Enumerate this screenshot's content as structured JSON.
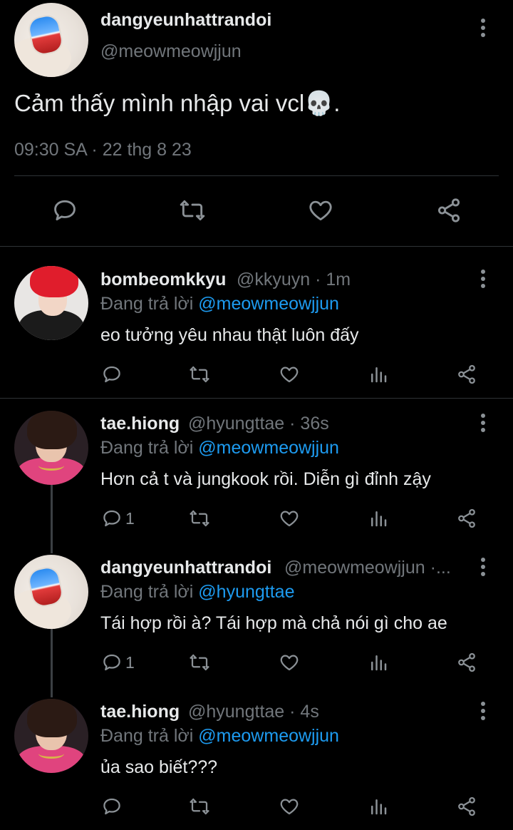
{
  "main_tweet": {
    "display_name": "dangyeunhattrandoi",
    "handle": "@meowmeowjjun",
    "text": "Cảm thấy mình nhập vai vcl💀.",
    "timestamp": "09:30 SA · 22 thg 8 23"
  },
  "replies": [
    {
      "display_name": "bombeomkkyu",
      "meta": "@kkyuyn · 1m",
      "replying_prefix": "Đang trả lời",
      "replying_to": "@meowmeowjjun",
      "text": "eo tưởng yêu nhau thật luôn đấy",
      "reply_count": ""
    },
    {
      "display_name": "tae.hiong",
      "meta": "@hyungttae · 36s",
      "replying_prefix": "Đang trả lời",
      "replying_to": "@meowmeowjjun",
      "text": "Hơn cả t và jungkook rồi. Diễn gì đỉnh zậy",
      "reply_count": "1"
    },
    {
      "display_name": "dangyeunhattrandoi",
      "meta": "@meowmeowjjun ·...",
      "replying_prefix": "Đang trả lời",
      "replying_to": "@hyungttae",
      "text": "Tái hợp rồi à? Tái hợp mà chả nói gì cho ae",
      "reply_count": "1"
    },
    {
      "display_name": "tae.hiong",
      "meta": "@hyungttae · 4s",
      "replying_prefix": "Đang trả lời",
      "replying_to": "@meowmeowjjun",
      "text": "ủa sao biết???",
      "reply_count": ""
    }
  ],
  "icons": {
    "reply": "reply-icon",
    "retweet": "retweet-icon",
    "like": "heart-icon",
    "views": "views-icon",
    "share": "share-icon",
    "more": "more-vertical-icon"
  },
  "colors": {
    "background": "#000000",
    "text": "#e7e9ea",
    "muted": "#71767b",
    "mention": "#1d9bf0",
    "icon": "#8b9196",
    "divider": "#2f3336"
  }
}
